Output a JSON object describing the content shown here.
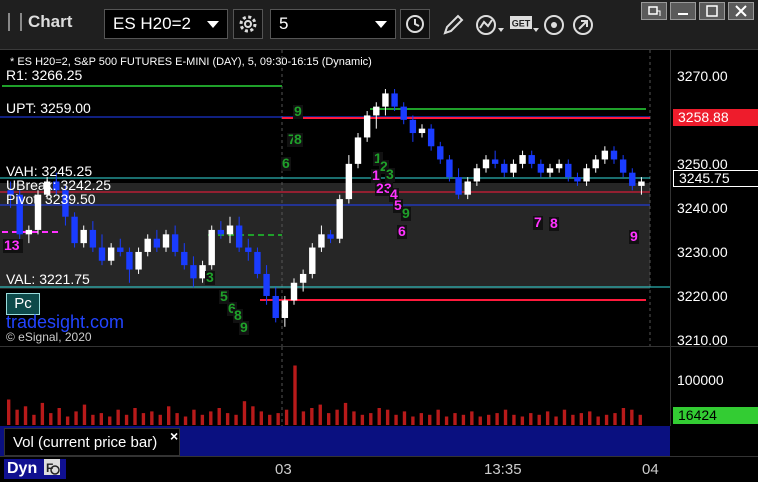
{
  "toolbar": {
    "app_title": "Chart",
    "symbol": "ES H20=2",
    "interval": "5"
  },
  "chart": {
    "header": "* ES H20=2, S&P 500 FUTURES E-MINI (DAY), 5, 09:30-16:15 (Dynamic)",
    "levels": {
      "r1": "R1: 3266.25",
      "upt": "UPT: 3259.00",
      "vah": "VAH: 3245.25",
      "ubreak": "UBreak: 3242.25",
      "pivot": "Pivot: 3239.50",
      "val": "VAL: 3221.75"
    },
    "pc_button": "Pc",
    "watermark": "tradesight.com",
    "copyright": "© eSignal, 2020",
    "price_ticks": [
      "3270.00",
      "3260.00",
      "3250.00",
      "3240.00",
      "3230.00",
      "3220.00",
      "3210.00"
    ],
    "price_badges": {
      "red": "3258.88",
      "last": "3245.75"
    },
    "seq_labels_magenta": [
      "13",
      "1",
      "2",
      "3",
      "4",
      "5",
      "6",
      "7",
      "8",
      "9"
    ],
    "seq_labels_green": [
      "9",
      "7",
      "8",
      "6",
      "1",
      "2",
      "3",
      "4",
      "5",
      "6",
      "7",
      "8",
      "9"
    ]
  },
  "volume": {
    "tick": "100000",
    "badge": "16424",
    "pane_label": "Vol (current price bar)",
    "close_symbol": "×"
  },
  "time_axis": [
    "03",
    "13:35",
    "04"
  ],
  "mode_label": "Dyn",
  "colors": {
    "bull_candle": "#ffffff",
    "bear_candle": "#1a3cff",
    "red_line": "#ff1a3c",
    "cyan_line": "#33dddd",
    "blue_line": "#2040ff",
    "green_line": "#1fa02a",
    "magenta": "#ff33ff",
    "value_area": "#262626",
    "watermark": "#2244ff",
    "volume_bar": "#b81a1a",
    "volume_badge": "#33cc33"
  },
  "chart_data": {
    "type": "candlestick",
    "ylim": [
      3210,
      3272
    ],
    "candles": [
      [
        3244,
        3246,
        3240,
        3243
      ],
      [
        3243,
        3244,
        3232,
        3234
      ],
      [
        3234,
        3236,
        3232,
        3235
      ],
      [
        3235,
        3244,
        3234,
        3243
      ],
      [
        3243,
        3247,
        3242,
        3246
      ],
      [
        3246,
        3248,
        3243,
        3244
      ],
      [
        3244,
        3245,
        3236,
        3238
      ],
      [
        3238,
        3239,
        3231,
        3232
      ],
      [
        3232,
        3236,
        3231,
        3235
      ],
      [
        3235,
        3237,
        3230,
        3231
      ],
      [
        3231,
        3234,
        3227,
        3228
      ],
      [
        3228,
        3232,
        3227,
        3231
      ],
      [
        3231,
        3233,
        3229,
        3230
      ],
      [
        3230,
        3231,
        3223,
        3226
      ],
      [
        3226,
        3231,
        3225,
        3230
      ],
      [
        3230,
        3234,
        3229,
        3233
      ],
      [
        3233,
        3235,
        3230,
        3231
      ],
      [
        3231,
        3235,
        3230,
        3234
      ],
      [
        3234,
        3236,
        3229,
        3230
      ],
      [
        3230,
        3232,
        3226,
        3227
      ],
      [
        3227,
        3229,
        3222,
        3224
      ],
      [
        3224,
        3228,
        3223,
        3227
      ],
      [
        3227,
        3236,
        3226,
        3235
      ],
      [
        3235,
        3237,
        3233,
        3234
      ],
      [
        3234,
        3238,
        3232,
        3236
      ],
      [
        3236,
        3238,
        3230,
        3231
      ],
      [
        3231,
        3233,
        3228,
        3230
      ],
      [
        3230,
        3231,
        3224,
        3225
      ],
      [
        3225,
        3227,
        3218,
        3220
      ],
      [
        3220,
        3222,
        3214,
        3215
      ],
      [
        3215,
        3220,
        3213,
        3219
      ],
      [
        3219,
        3224,
        3218,
        3223
      ],
      [
        3223,
        3226,
        3221,
        3225
      ],
      [
        3225,
        3232,
        3224,
        3231
      ],
      [
        3231,
        3236,
        3230,
        3234
      ],
      [
        3234,
        3235,
        3232,
        3233
      ],
      [
        3233,
        3243,
        3232,
        3242
      ],
      [
        3242,
        3252,
        3241,
        3250
      ],
      [
        3250,
        3257,
        3249,
        3256
      ],
      [
        3256,
        3262,
        3255,
        3261
      ],
      [
        3261,
        3264,
        3258,
        3263
      ],
      [
        3263,
        3267,
        3261,
        3266
      ],
      [
        3266,
        3267,
        3262,
        3263
      ],
      [
        3263,
        3264,
        3259,
        3260
      ],
      [
        3260,
        3261,
        3255,
        3257
      ],
      [
        3257,
        3259,
        3256,
        3258
      ],
      [
        3258,
        3259,
        3253,
        3254
      ],
      [
        3254,
        3255,
        3250,
        3251
      ],
      [
        3251,
        3252,
        3246,
        3247
      ],
      [
        3247,
        3249,
        3242,
        3243
      ],
      [
        3243,
        3247,
        3242,
        3246
      ],
      [
        3246,
        3250,
        3245,
        3249
      ],
      [
        3249,
        3252,
        3248,
        3251
      ],
      [
        3251,
        3253,
        3249,
        3250
      ],
      [
        3250,
        3251,
        3247,
        3248
      ],
      [
        3248,
        3251,
        3247,
        3250
      ],
      [
        3250,
        3253,
        3249,
        3252
      ],
      [
        3252,
        3253,
        3249,
        3250
      ],
      [
        3250,
        3251,
        3247,
        3248
      ],
      [
        3248,
        3250,
        3247,
        3249
      ],
      [
        3249,
        3251,
        3248,
        3250
      ],
      [
        3250,
        3251,
        3246,
        3247
      ],
      [
        3247,
        3248,
        3245,
        3246
      ],
      [
        3246,
        3250,
        3245,
        3249
      ],
      [
        3249,
        3252,
        3248,
        3251
      ],
      [
        3251,
        3254,
        3250,
        3253
      ],
      [
        3253,
        3254,
        3250,
        3251
      ],
      [
        3251,
        3252,
        3247,
        3248
      ],
      [
        3248,
        3249,
        3244,
        3245
      ],
      [
        3245,
        3247,
        3243,
        3246
      ]
    ]
  }
}
